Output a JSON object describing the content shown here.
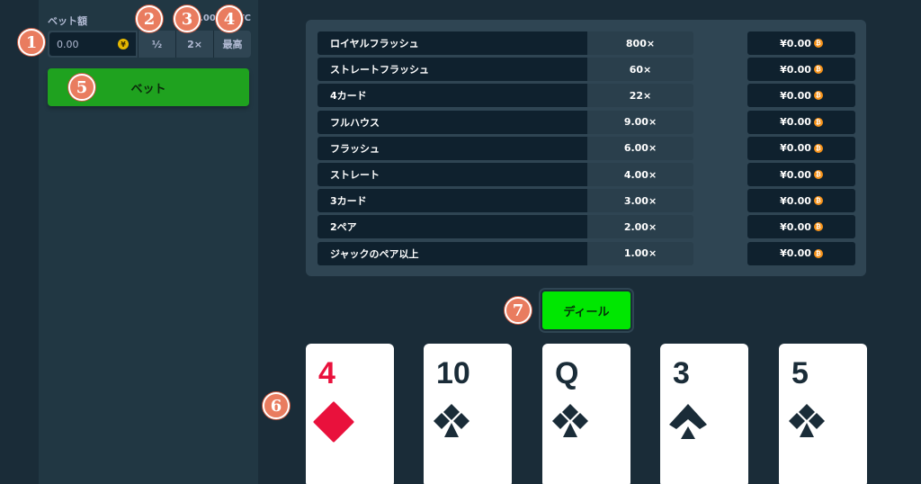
{
  "sidebar": {
    "bet_label": "ベット額",
    "balance_text": "0.0000 BTC",
    "bet_value": "0.00",
    "currency_symbol": "¥",
    "half_label": "½",
    "double_label": "2×",
    "max_label": "最高",
    "bet_button_label": "ベット"
  },
  "paytable": {
    "rows": [
      {
        "hand": "ロイヤルフラッシュ",
        "multiplier": "800×",
        "payout": "¥0.00"
      },
      {
        "hand": "ストレートフラッシュ",
        "multiplier": "60×",
        "payout": "¥0.00"
      },
      {
        "hand": "4カード",
        "multiplier": "22×",
        "payout": "¥0.00"
      },
      {
        "hand": "フルハウス",
        "multiplier": "9.00×",
        "payout": "¥0.00"
      },
      {
        "hand": "フラッシュ",
        "multiplier": "6.00×",
        "payout": "¥0.00"
      },
      {
        "hand": "ストレート",
        "multiplier": "4.00×",
        "payout": "¥0.00"
      },
      {
        "hand": "3カード",
        "multiplier": "3.00×",
        "payout": "¥0.00"
      },
      {
        "hand": "2ペア",
        "multiplier": "2.00×",
        "payout": "¥0.00"
      },
      {
        "hand": "ジャックのペア以上",
        "multiplier": "1.00×",
        "payout": "¥0.00"
      }
    ]
  },
  "deal_button_label": "ディール",
  "cards": [
    {
      "rank": "4",
      "suit": "diamond",
      "color": "#e9113c"
    },
    {
      "rank": "10",
      "suit": "club",
      "color": "#1a2c38"
    },
    {
      "rank": "Q",
      "suit": "club",
      "color": "#1a2c38"
    },
    {
      "rank": "3",
      "suit": "spade",
      "color": "#1a2c38"
    },
    {
      "rank": "5",
      "suit": "club",
      "color": "#1a2c38"
    }
  ],
  "badges": [
    "1",
    "2",
    "3",
    "4",
    "5",
    "6",
    "7"
  ],
  "colors": {
    "background": "#1a2c38",
    "sidebar": "#213743",
    "bet_button": "#1fa21f",
    "deal_button": "#00e701",
    "badge": "#e97c5f"
  }
}
